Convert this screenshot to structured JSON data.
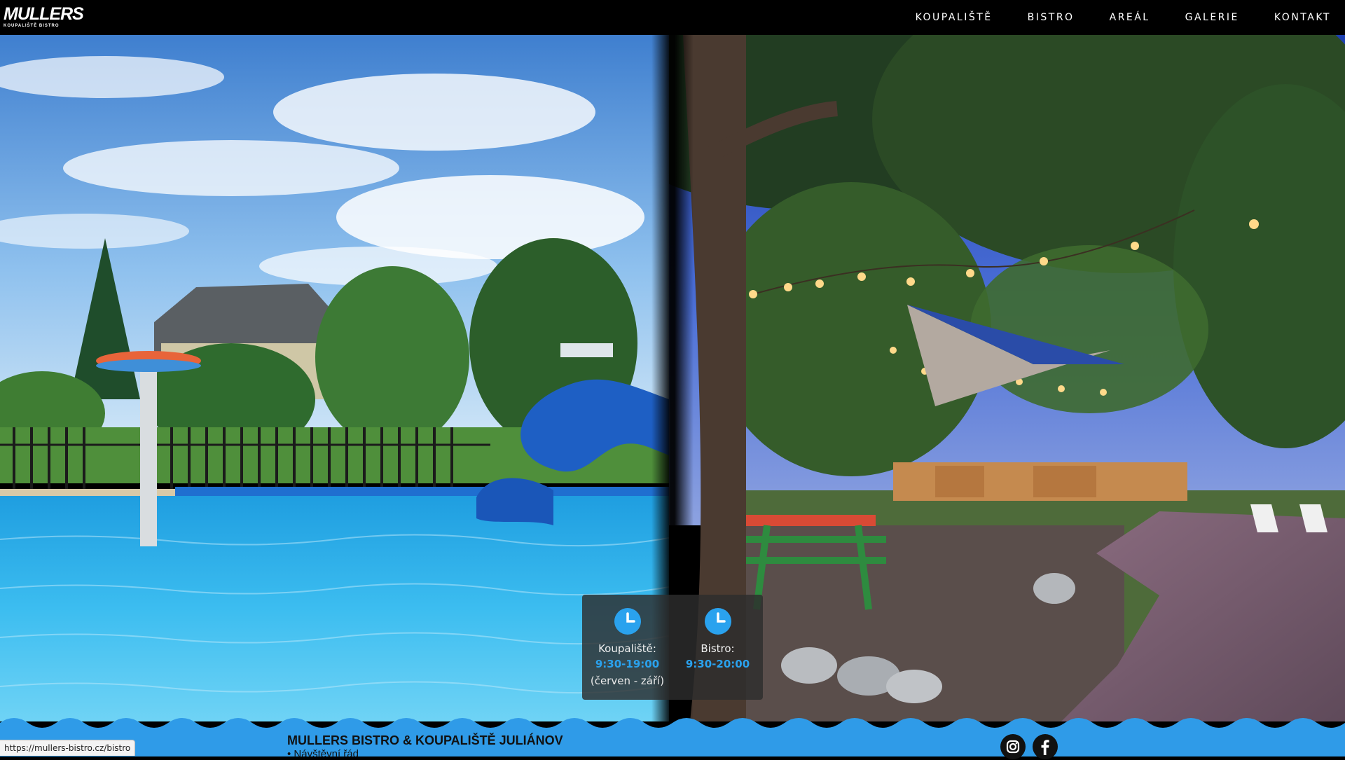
{
  "header": {
    "logo_text": "MULLERS",
    "logo_subtext": "KOUPALIŠTĚ BISTRO",
    "nav": [
      "KOUPALIŠTĚ",
      "BISTRO",
      "AREÁL",
      "GALERIE",
      "KONTAKT"
    ]
  },
  "hours": {
    "pool": {
      "label": "Koupaliště:",
      "time": "9:30-19:00",
      "note": "(červen - září)"
    },
    "bistro": {
      "label": "Bistro:",
      "time": "9:30-20:00"
    }
  },
  "footer": {
    "title": "MULLERS BISTRO & KOUPALIŠTĚ JULIÁNOV",
    "link": "Návštěvní řád",
    "social": [
      "instagram-icon",
      "facebook-icon"
    ]
  },
  "status_bar": {
    "url": "https://mullers-bistro.cz/bistro"
  },
  "colors": {
    "accent": "#2aa2ee",
    "wave": "#2f9be8",
    "nav_bg": "#000000"
  }
}
